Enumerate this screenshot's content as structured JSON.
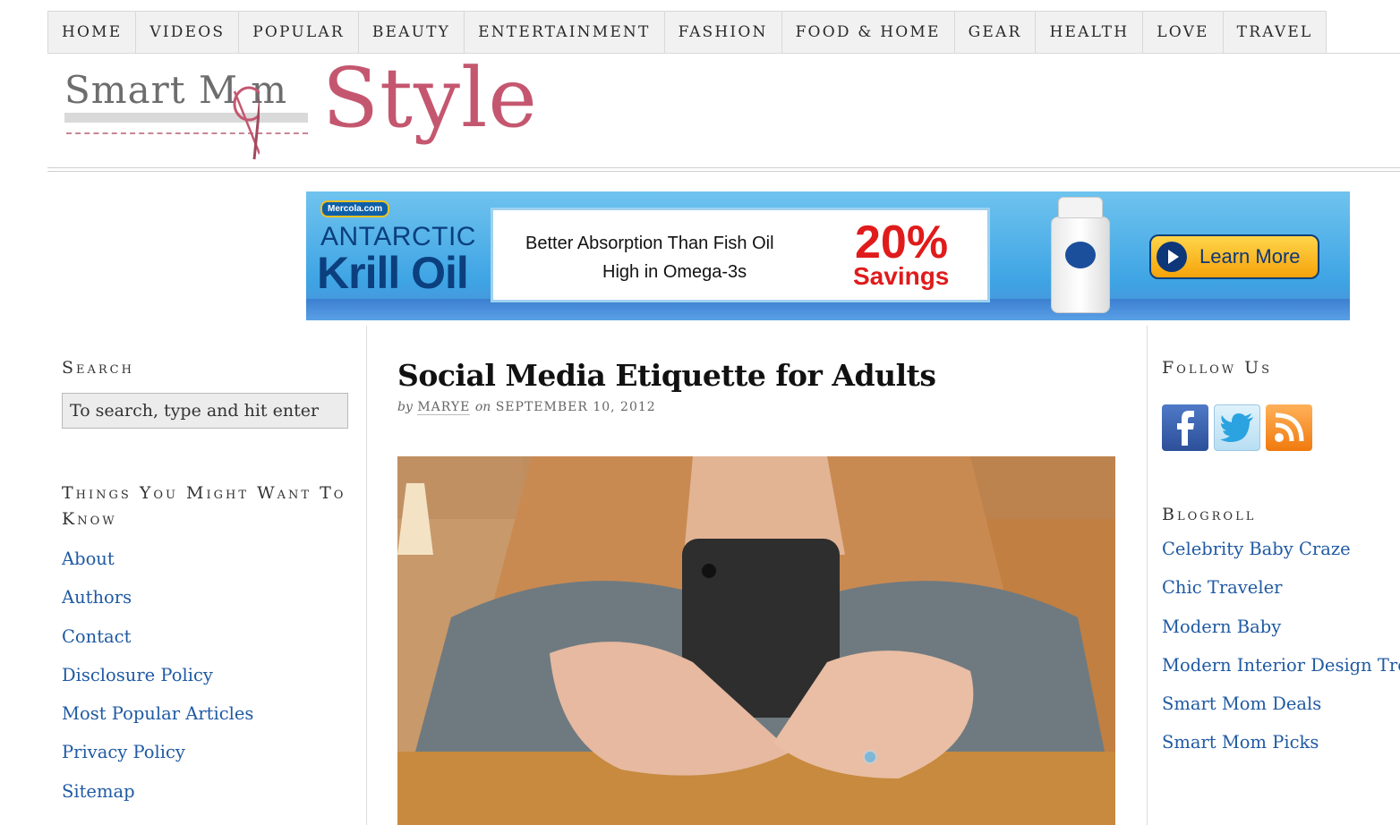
{
  "nav": {
    "items": [
      "HOME",
      "VIDEOS",
      "POPULAR",
      "BEAUTY",
      "ENTERTAINMENT",
      "FASHION",
      "FOOD & HOME",
      "GEAR",
      "HEALTH",
      "LOVE",
      "TRAVEL"
    ]
  },
  "logo": {
    "smart_mom": "Smart M  m",
    "style": "Style"
  },
  "ad": {
    "brand": "Mercola.com",
    "product_line1": "ANTARCTIC",
    "product_line2": "Krill Oil",
    "tagline1": "Better Absorption Than Fish Oil",
    "tagline2": "High in Omega-3s",
    "discount": "20%",
    "discount_label": "Savings",
    "cta": "Learn More"
  },
  "sidebar_left": {
    "search_title": "Search",
    "search_placeholder": "To search, type and hit enter",
    "things_title": "Things You Might Want To Know",
    "links": [
      "About",
      "Authors",
      "Contact",
      "Disclosure Policy",
      "Most Popular Articles",
      "Privacy Policy",
      "Sitemap"
    ]
  },
  "post": {
    "title": "Social Media Etiquette for Adults",
    "by": "by",
    "author": "MARYE",
    "on": "on",
    "date": "SEPTEMBER 10, 2012",
    "image_icon": "photo-woman-using-phone"
  },
  "sidebar_right": {
    "follow_title": "Follow Us",
    "social_icons": [
      "facebook-icon",
      "twitter-icon",
      "rss-icon"
    ],
    "blogroll_title": "Blogroll",
    "blogroll": [
      "Celebrity Baby Craze",
      "Chic Traveler",
      "Modern Baby",
      "Modern Interior Design Tren",
      "Smart Mom Deals",
      "Smart Mom Picks"
    ]
  },
  "colors": {
    "link": "#1f5aa3",
    "brand_pink": "#c4576f",
    "ad_red": "#e01b1b"
  }
}
